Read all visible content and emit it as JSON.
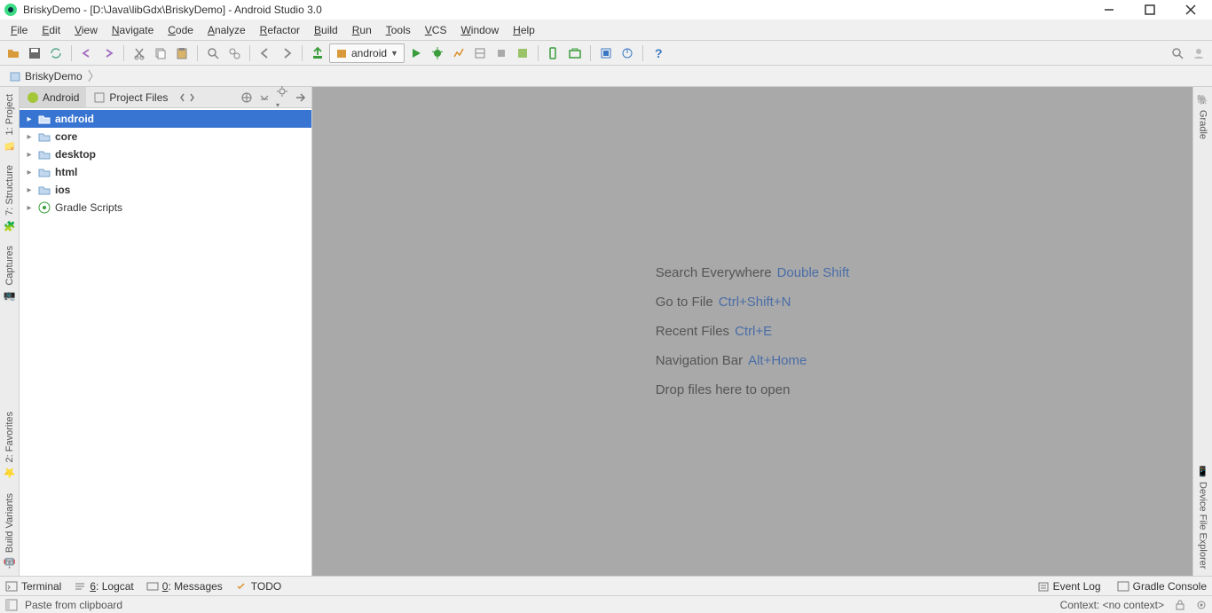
{
  "window": {
    "title": "BriskyDemo - [D:\\Java\\libGdx\\BriskyDemo] - Android Studio 3.0"
  },
  "menu": {
    "items": [
      "File",
      "Edit",
      "View",
      "Navigate",
      "Code",
      "Analyze",
      "Refactor",
      "Build",
      "Run",
      "Tools",
      "VCS",
      "Window",
      "Help"
    ]
  },
  "run_config": {
    "label": "android"
  },
  "breadcrumb": {
    "item": "BriskyDemo"
  },
  "left_gutter": {
    "items": [
      "1: Project",
      "7: Structure",
      "Captures",
      "2: Favorites",
      "Build Variants"
    ]
  },
  "right_gutter": {
    "items": [
      "Gradle",
      "Device File Explorer"
    ]
  },
  "project_panel": {
    "tab_android": "Android",
    "tab_files": "Project Files",
    "tree": [
      {
        "label": "android",
        "bold": true,
        "selected": true,
        "icon": "folder"
      },
      {
        "label": "core",
        "bold": true,
        "icon": "folder"
      },
      {
        "label": "desktop",
        "bold": true,
        "icon": "folder"
      },
      {
        "label": "html",
        "bold": true,
        "icon": "folder"
      },
      {
        "label": "ios",
        "bold": true,
        "icon": "folder"
      },
      {
        "label": "Gradle Scripts",
        "bold": false,
        "icon": "gradle"
      }
    ]
  },
  "hints": {
    "rows": [
      {
        "label": "Search Everywhere",
        "shortcut": "Double Shift"
      },
      {
        "label": "Go to File",
        "shortcut": "Ctrl+Shift+N"
      },
      {
        "label": "Recent Files",
        "shortcut": "Ctrl+E"
      },
      {
        "label": "Navigation Bar",
        "shortcut": "Alt+Home"
      },
      {
        "label": "Drop files here to open",
        "shortcut": ""
      }
    ]
  },
  "bottom_tools": {
    "terminal": "Terminal",
    "logcat": "6: Logcat",
    "messages": "0: Messages",
    "todo": "TODO",
    "eventlog": "Event Log",
    "gradle_console": "Gradle Console"
  },
  "status": {
    "message": "Paste from clipboard",
    "context": "Context: <no context>"
  }
}
